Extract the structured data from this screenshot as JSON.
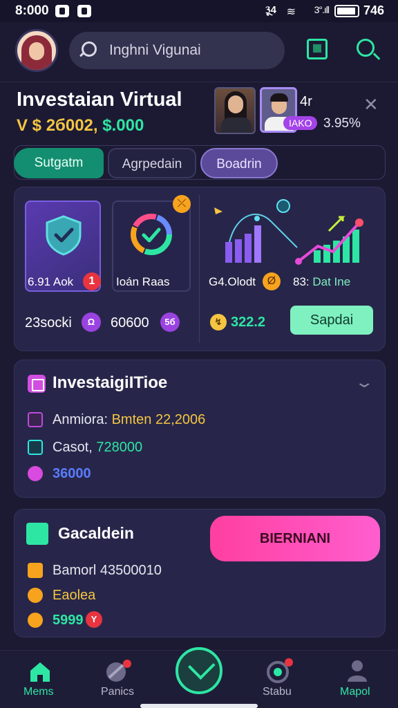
{
  "status_bar": {
    "time": "8:000",
    "battery_text": "746",
    "extra_text": "3ૂ4",
    "signal_text": "3°.ıll"
  },
  "header": {
    "search_placeholder": "Inghni Vigunai"
  },
  "summary": {
    "title": "Investaian Virtual",
    "amount_prefix": "V $ 2б002,",
    "amount_value": "$.000",
    "photo_count": "4r",
    "photo_badge": "IAKO",
    "percent": "3.95%"
  },
  "tabs": [
    {
      "label": "Sutgatm"
    },
    {
      "label": "Agrpedain"
    },
    {
      "label": "Boadrin"
    }
  ],
  "card1": {
    "tile1_label": "6.91 Aok",
    "tile1_badge": "1",
    "tile2_label": "Ioán Raas",
    "tile2_badge": "⤫",
    "stat1_text": "23socki",
    "stat1_badge": "Ω",
    "stat2_text": "60600",
    "stat2_badge": "5б",
    "chart_label_left": "G4.Olodt",
    "chart_label_left_badge": "Ø",
    "chart_label_right_prefix": "83:",
    "chart_label_right": "Dat Ine",
    "money_badge": "↯",
    "money_value": "322.2",
    "button_label": "Sapdai"
  },
  "card2": {
    "title": "InvestaigiITioe",
    "row1_label": "Anmiora:",
    "row1_value": "Bmten 22,2006",
    "row2_label": "Casot,",
    "row2_value": "728000",
    "row3_value": "36000"
  },
  "card3": {
    "title": "Gacaldein",
    "button_label": "BIERNIANI",
    "row1_text": "Bamorl 43500010",
    "row2_text": "Eaolea",
    "row3_value": "5999",
    "row3_badge": "Y"
  },
  "bottom_nav": {
    "items": [
      {
        "label": "Mems"
      },
      {
        "label": "Panics"
      },
      {
        "label": "Stabu"
      },
      {
        "label": "Mapol"
      }
    ]
  },
  "colors": {
    "accent_green": "#2ee6a3",
    "accent_pink": "#ff3fa0",
    "accent_purple": "#9a43e0",
    "accent_gold": "#f5c542",
    "background": "#1c1a33"
  }
}
